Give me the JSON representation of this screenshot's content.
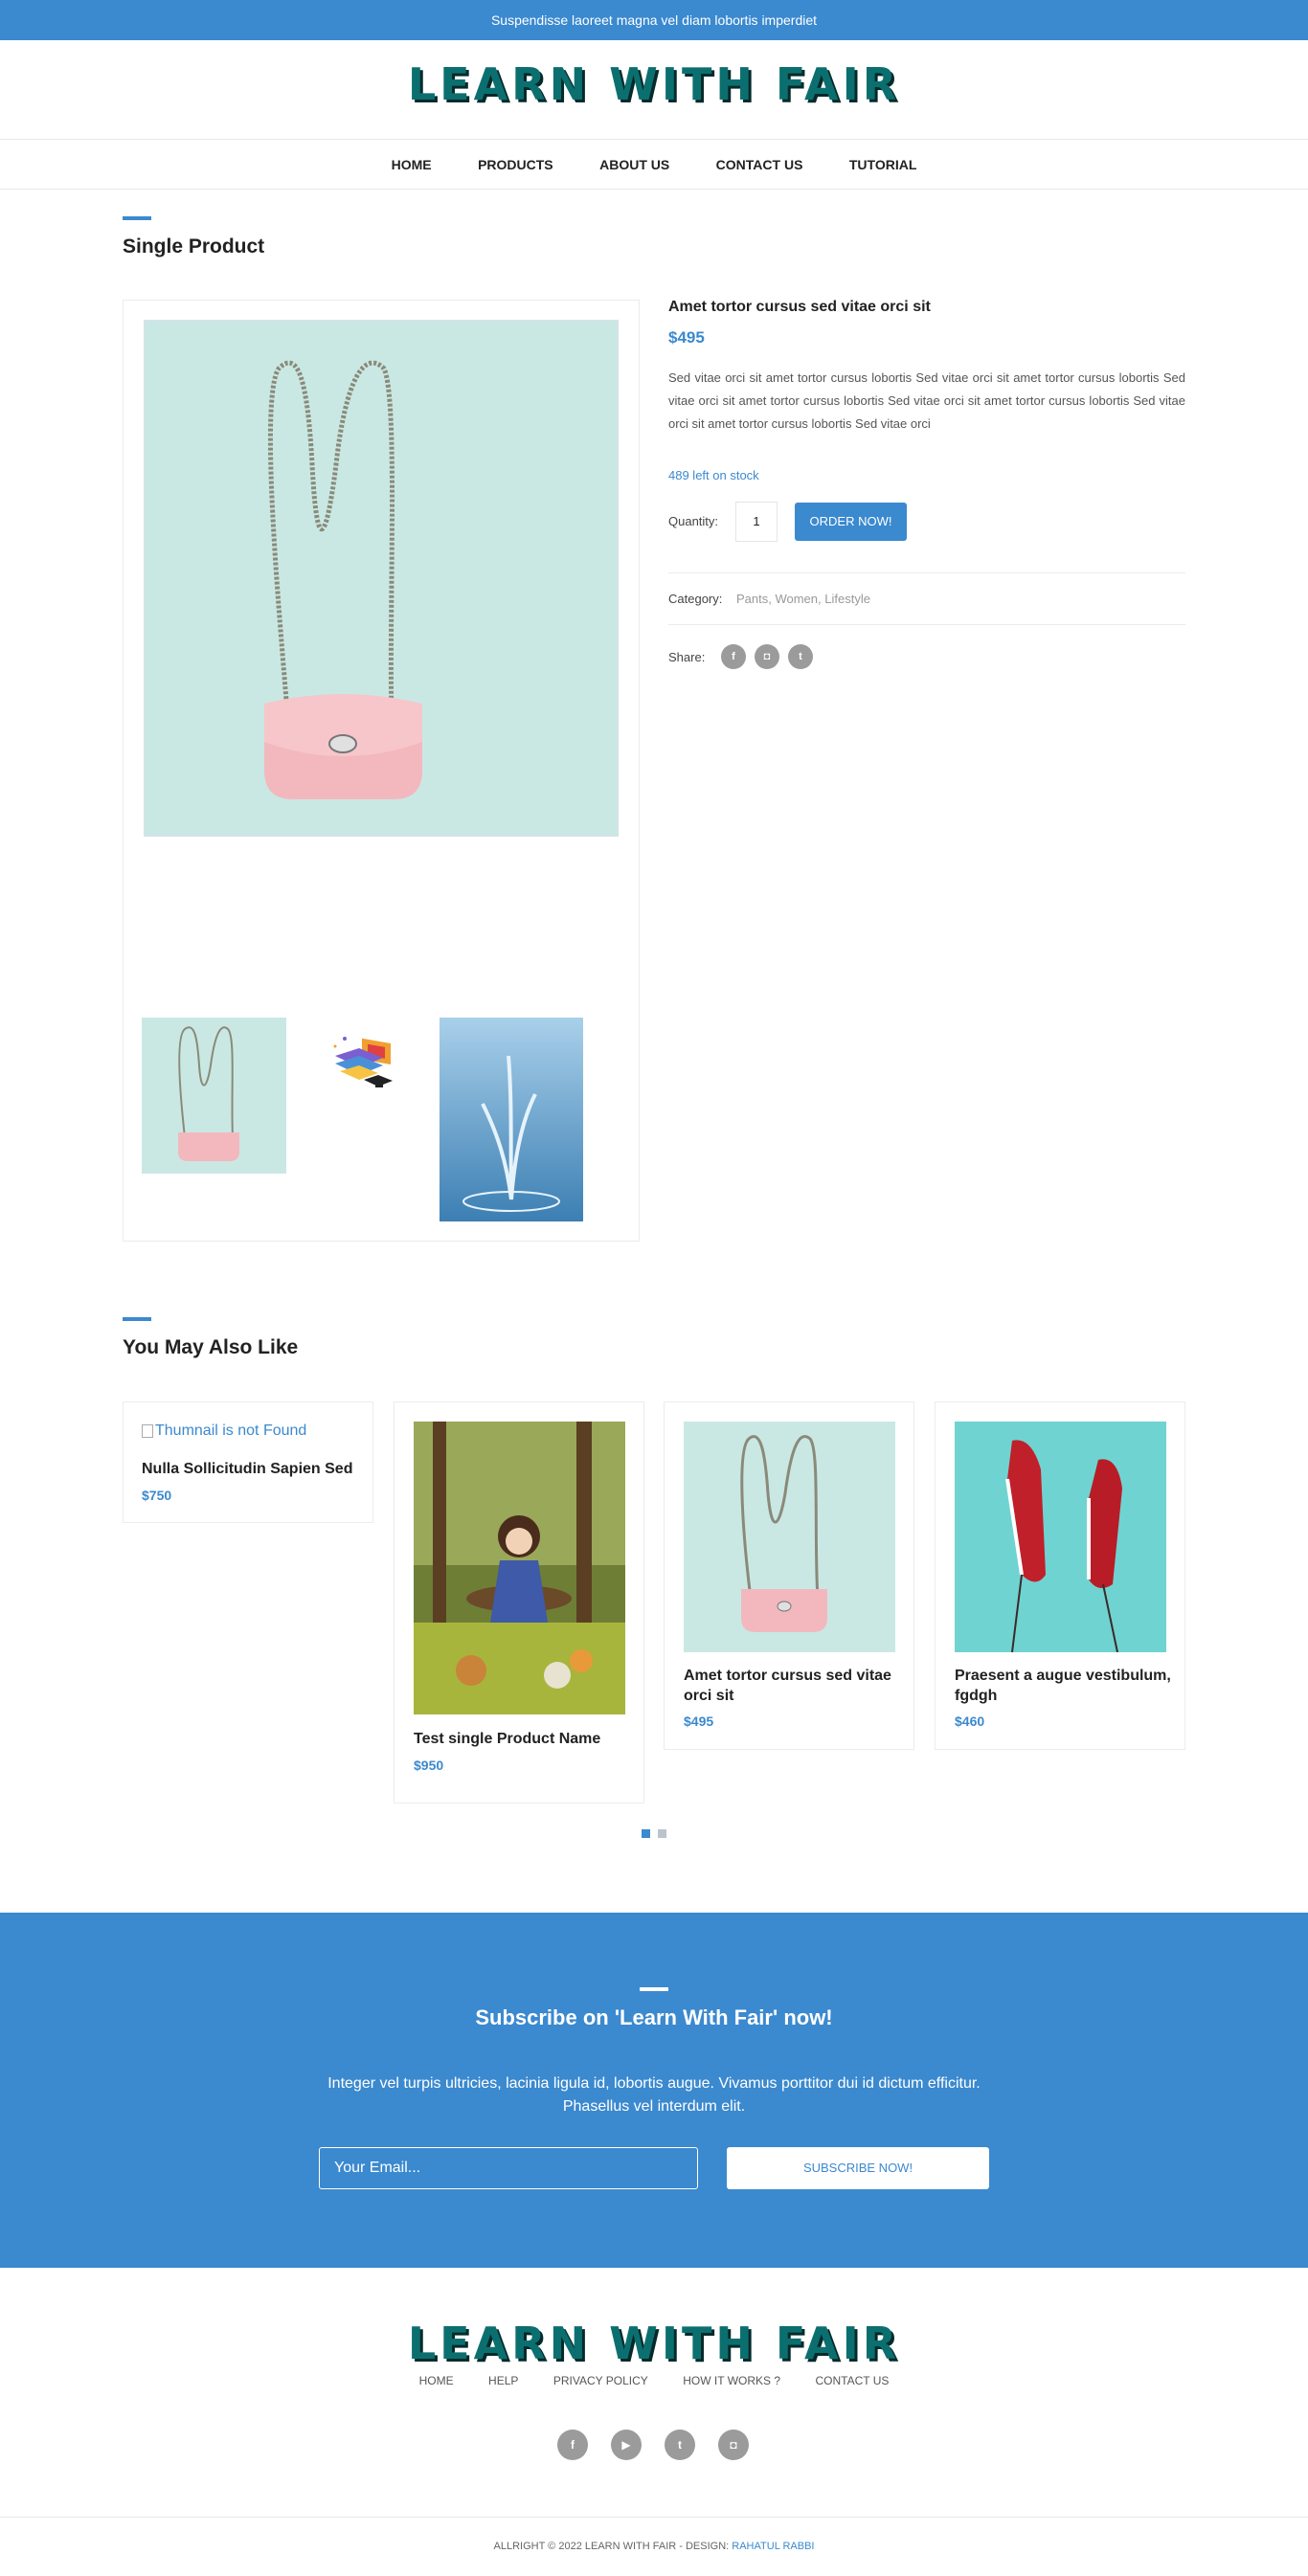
{
  "topbar": {
    "text": "Suspendisse laoreet magna vel diam lobortis imperdiet"
  },
  "brand": {
    "logo_text": "LEARN WITH FAIR"
  },
  "nav": {
    "items": [
      "HOME",
      "PRODUCTS",
      "ABOUT US",
      "CONTACT US",
      "TUTORIAL"
    ]
  },
  "product_section": {
    "title": "Single Product"
  },
  "product": {
    "name": "Amet tortor cursus sed vitae orci sit",
    "price": "$495",
    "description": "Sed vitae orci sit amet tortor cursus lobortis Sed vitae orci sit amet tortor cursus lobortis Sed vitae orci sit amet tortor cursus lobortis Sed vitae orci sit amet tortor cursus lobortis Sed vitae orci sit amet tortor cursus lobortis Sed vitae orci",
    "stock": "489 left on stock",
    "quantity_label": "Quantity:",
    "quantity_value": "1",
    "order_label": "ORDER NOW!",
    "category_label": "Category:",
    "categories": "Pants, Women, Lifestyle",
    "share_label": "Share:",
    "share_icons": [
      "facebook-icon",
      "instagram-icon",
      "twitter-icon"
    ]
  },
  "related": {
    "title": "You May Also Like",
    "items": [
      {
        "image_alt": "Thumnail is not Found",
        "name": "Nulla Sollicitudin Sapien Sed",
        "price": "$750"
      },
      {
        "name": "Test single Product Name",
        "price": "$950"
      },
      {
        "name": "Amet tortor cursus sed vitae orci sit",
        "price": "$495"
      },
      {
        "name": "Praesent a augue vestibulum, fgdgh",
        "price": "$460"
      }
    ],
    "pages": 2,
    "active_page": 1
  },
  "subscribe": {
    "title": "Subscribe on 'Learn With Fair' now!",
    "text": "Integer vel turpis ultricies, lacinia ligula id, lobortis augue. Vivamus porttitor dui id dictum efficitur. Phasellus vel interdum elit.",
    "placeholder": "Your Email...",
    "button_label": "SUBSCRIBE NOW!"
  },
  "footer": {
    "links": [
      "HOME",
      "HELP",
      "PRIVACY POLICY",
      "HOW IT WORKS ?",
      "CONTACT US"
    ],
    "social_icons": [
      "facebook-icon",
      "youtube-icon",
      "twitter-icon",
      "instagram-icon"
    ],
    "copyright": "ALLRIGHT © 2022 LEARN WITH FAIR - DESIGN:",
    "designer": "RAHATUL RABBI"
  },
  "colors": {
    "accent": "#3b89cf",
    "logo": "#0c6f6f"
  }
}
